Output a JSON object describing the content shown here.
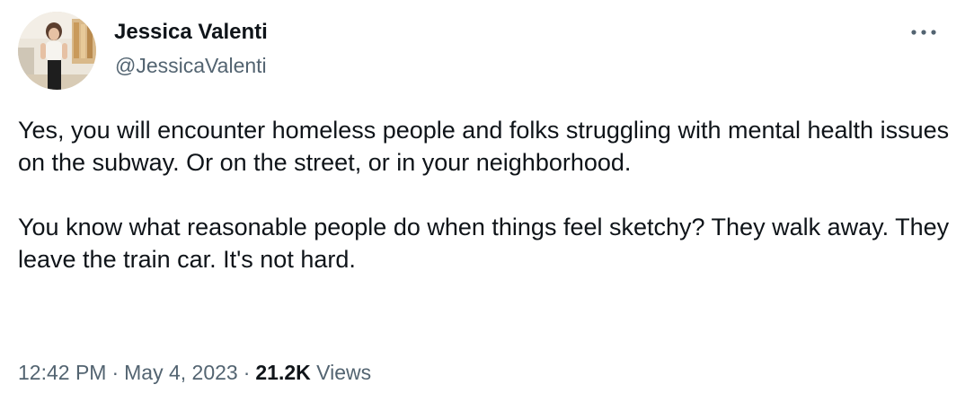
{
  "author": {
    "display_name": "Jessica Valenti",
    "handle": "@JessicaValenti",
    "avatar_icon": "profile-photo"
  },
  "more_button": {
    "icon": "more-horizontal-icon"
  },
  "tweet": {
    "paragraphs": [
      "Yes, you will encounter homeless people and folks struggling with mental health issues on the subway. Or on the street, or in your neighborhood.",
      "You know what reasonable people do when things feel sketchy? They walk away. They leave the train car. It's not hard."
    ]
  },
  "meta": {
    "time": "12:42 PM",
    "separator": "·",
    "date": "May 4, 2023",
    "views_count": "21.2K",
    "views_label": "Views"
  },
  "colors": {
    "text_primary": "#0f1419",
    "text_secondary": "#536471"
  }
}
